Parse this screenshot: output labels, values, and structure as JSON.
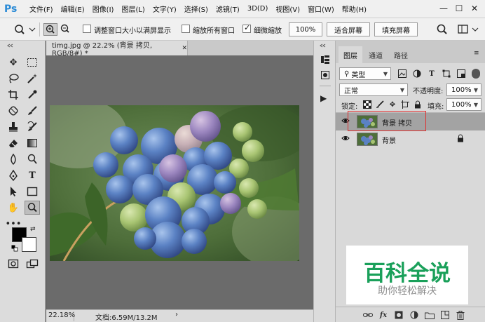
{
  "app": {
    "logo": "Ps"
  },
  "menu": [
    "文件(F)",
    "编辑(E)",
    "图像(I)",
    "图层(L)",
    "文字(Y)",
    "选择(S)",
    "滤镜(T)",
    "3D(D)",
    "视图(V)",
    "窗口(W)",
    "帮助(H)"
  ],
  "options": {
    "resize_windows": "调整窗口大小以满屏显示",
    "zoom_all": "缩放所有窗口",
    "scrubby_zoom": "细微缩放",
    "zoom_100": "100%",
    "fit_screen": "适合屏幕",
    "fill_screen": "填充屏幕"
  },
  "document": {
    "tab_title": "timg.jpg @ 22.2% (背景 拷贝, RGB/8#) *",
    "zoom": "22.18%",
    "doc_size": "文档:6.59M/13.2M"
  },
  "layers_panel": {
    "tabs": [
      "图层",
      "通道",
      "路径"
    ],
    "filter_kind": "类型",
    "blend_mode": "正常",
    "opacity_label": "不透明度:",
    "opacity_value": "100%",
    "lock_label": "锁定:",
    "fill_label": "填充:",
    "fill_value": "100%",
    "layers": [
      {
        "name": "背景 拷贝",
        "selected": true
      },
      {
        "name": "背景",
        "selected": false
      }
    ]
  },
  "watermark": {
    "title": "百科全说",
    "subtitle": "助你轻松解决"
  },
  "colors": {
    "accent_selection": "#e0302f",
    "watermark_green": "#1aa05a",
    "ps_blue": "#2b8bd6"
  }
}
